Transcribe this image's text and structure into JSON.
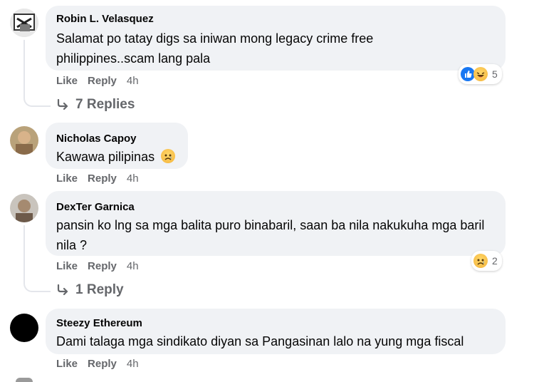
{
  "comments": [
    {
      "author": "Robin L. Velasquez",
      "text": "Salamat po tatay digs sa iniwan mong legacy crime free philippines..scam lang pala",
      "actions": {
        "like": "Like",
        "reply": "Reply",
        "time": "4h"
      },
      "reactions": {
        "icons": [
          "like-icon",
          "haha-icon"
        ],
        "count": "5"
      },
      "replies": "7 Replies"
    },
    {
      "author": "Nicholas Capoy",
      "text": "Kawawa pilipinas",
      "emoji": "sad-face-icon",
      "actions": {
        "like": "Like",
        "reply": "Reply",
        "time": "4h"
      }
    },
    {
      "author": "DexTer Garnica",
      "text": "pansin ko lng sa mga balita puro binabaril, saan ba nila nakukuha mga baril nila ?",
      "actions": {
        "like": "Like",
        "reply": "Reply",
        "time": "4h"
      },
      "reactions": {
        "icons": [
          "sad-icon"
        ],
        "count": "2"
      },
      "replies": "1 Reply"
    },
    {
      "author": "Steezy Ethereum",
      "text": "Dami talaga mga sindikato diyan sa Pangasinan lalo na yung mga fiscal",
      "actions": {
        "like": "Like",
        "reply": "Reply",
        "time": "4h"
      }
    }
  ],
  "colors": {
    "bubble": "#f0f2f5",
    "like_blue": "#1877f2",
    "meta_gray": "#65676b"
  }
}
